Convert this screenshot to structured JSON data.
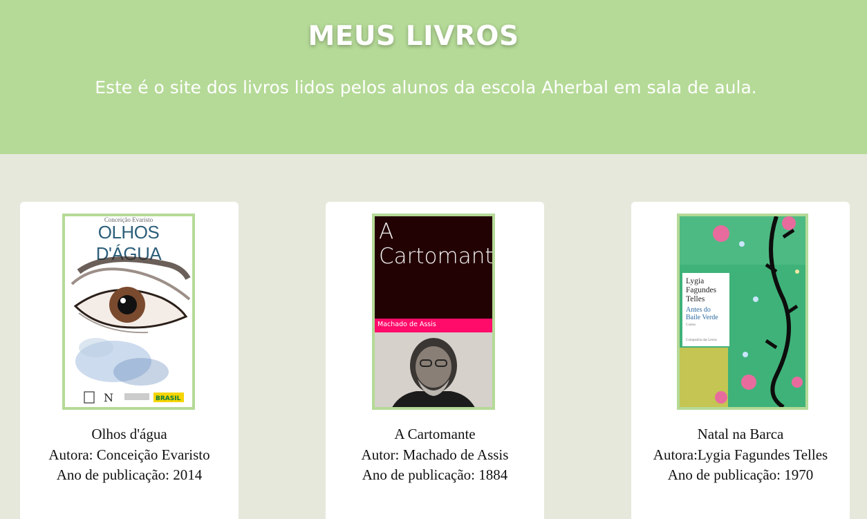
{
  "header": {
    "title": "MEUS LIVROS",
    "subtitle": "Este é o site dos livros lidos pelos alunos da escola Aherbal em sala de aula."
  },
  "colors": {
    "header_bg": "#b5da97",
    "page_bg": "#e6e8dc",
    "card_bg": "#ffffff",
    "cover_border": "#b5da97"
  },
  "books": [
    {
      "title": "Olhos d'água",
      "author": "Autora: Conceição Evaristo",
      "year": "Ano de publicação: 2014",
      "cover": {
        "top_text": "Conceição Evaristo",
        "title_text": "OLHOS D'ÁGUA",
        "logo_text": "BRASIL"
      }
    },
    {
      "title": "A Cartomante",
      "author": "Autor: Machado de Assis",
      "year": "Ano de publicação: 1884",
      "cover": {
        "title_line1": "A",
        "title_line2": "Cartomante",
        "author_text": "Machado de Assis"
      }
    },
    {
      "title": "Natal na Barca",
      "author": "Autora:Lygia Fagundes Telles",
      "year": "Ano de publicação: 1970",
      "cover": {
        "author_line1": "Lygia",
        "author_line2": "Fagundes",
        "author_line3": "Telles",
        "title_line1": "Antes do",
        "title_line2": "Baile Verde",
        "subtitle": "Contos",
        "publisher": "Companhia das Letras"
      }
    }
  ]
}
